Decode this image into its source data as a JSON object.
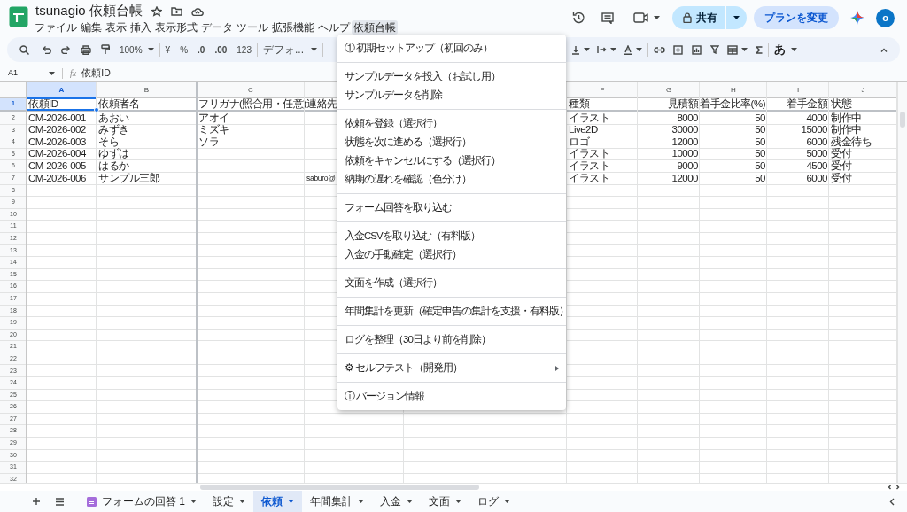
{
  "title": "tsunagio 依頼台帳",
  "menu_bar": [
    {
      "label": "ファイル",
      "selected": false
    },
    {
      "label": "編集",
      "selected": false
    },
    {
      "label": "表示",
      "selected": false
    },
    {
      "label": "挿入",
      "selected": false
    },
    {
      "label": "表示形式",
      "selected": false
    },
    {
      "label": "データ",
      "selected": false
    },
    {
      "label": "ツール",
      "selected": false
    },
    {
      "label": "拡張機能",
      "selected": false
    },
    {
      "label": "ヘルプ",
      "selected": false
    },
    {
      "label": "依頼台帳",
      "selected": true
    }
  ],
  "share_button": "共有",
  "plan_button": "プランを変更",
  "avatar": "o",
  "toolbar": {
    "zoom": "100%",
    "currency": "¥",
    "percent": "%",
    "decrease_decimal": ".0",
    "increase_decimal": ".00",
    "number_format": "123",
    "font": "デフォ...",
    "font_size_minus": "−",
    "input_tools": "あ"
  },
  "formula_bar": {
    "cell_ref": "A1",
    "fx": "fx",
    "formula": "依頼ID"
  },
  "columns": [
    {
      "letter": "A",
      "kind": "text",
      "selected": true
    },
    {
      "letter": "B",
      "kind": "text",
      "selected": false
    },
    {
      "letter": "C",
      "kind": "text",
      "selected": false
    },
    {
      "kind": "text"
    },
    {
      "kind": "text"
    },
    {
      "letter": "F",
      "kind": "text",
      "selected": false
    },
    {
      "letter": "G",
      "kind": "number",
      "selected": false
    },
    {
      "letter": "H",
      "kind": "number",
      "selected": false
    },
    {
      "letter": "I",
      "kind": "number",
      "selected": false
    },
    {
      "letter": "J",
      "kind": "text",
      "selected": false
    }
  ],
  "rows": [
    {
      "number": "1",
      "selected": true,
      "cells": {
        "0": "依頼ID",
        "1": "依頼者名",
        "2": "フリガナ(照合用・任意)",
        "3": "連絡先",
        "5": "種類",
        "6": "見積額",
        "7": "着手金比率(%)",
        "8": "着手金額",
        "9": "状態"
      }
    },
    {
      "number": "2",
      "selected": false,
      "cells": {
        "0": "CM-2026-001",
        "1": "あおい",
        "2": "アオイ",
        "5": "イラスト",
        "6": "8000",
        "7": "50",
        "8": "4000",
        "9": "制作中"
      }
    },
    {
      "number": "3",
      "selected": false,
      "cells": {
        "0": "CM-2026-002",
        "1": "みずき",
        "2": "ミズキ",
        "5": "Live2D",
        "6": "30000",
        "7": "50",
        "8": "15000",
        "9": "制作中"
      }
    },
    {
      "number": "4",
      "selected": false,
      "cells": {
        "0": "CM-2026-003",
        "1": "そら",
        "2": "ソラ",
        "5": "ロゴ",
        "6": "12000",
        "7": "50",
        "8": "6000",
        "9": "残金待ち"
      }
    },
    {
      "number": "5",
      "selected": false,
      "cells": {
        "0": "CM-2026-004",
        "1": "ゆずは",
        "5": "イラスト",
        "6": "10000",
        "7": "50",
        "8": "5000",
        "9": "受付"
      }
    },
    {
      "number": "6",
      "selected": false,
      "cells": {
        "0": "CM-2026-005",
        "1": "はるか",
        "5": "イラスト",
        "6": "9000",
        "7": "50",
        "8": "4500",
        "9": "受付"
      }
    },
    {
      "number": "7",
      "selected": false,
      "cells": {
        "0": "CM-2026-006",
        "1": "サンプル三郎",
        "3": "saburo@",
        "5": "イラスト",
        "6": "12000",
        "7": "50",
        "8": "6000",
        "9": "受付"
      }
    },
    {
      "number": "8",
      "selected": false
    },
    {
      "number": "9",
      "selected": false
    },
    {
      "number": "10",
      "selected": false
    },
    {
      "number": "11",
      "selected": false
    },
    {
      "number": "12",
      "selected": false
    },
    {
      "number": "13",
      "selected": false
    },
    {
      "number": "14",
      "selected": false
    },
    {
      "number": "15",
      "selected": false
    },
    {
      "number": "16",
      "selected": false
    },
    {
      "number": "17",
      "selected": false
    },
    {
      "number": "18",
      "selected": false
    },
    {
      "number": "19",
      "selected": false
    },
    {
      "number": "20",
      "selected": false
    },
    {
      "number": "21",
      "selected": false
    },
    {
      "number": "22",
      "selected": false
    },
    {
      "number": "23",
      "selected": false
    },
    {
      "number": "24",
      "selected": false
    },
    {
      "number": "25",
      "selected": false
    },
    {
      "number": "26",
      "selected": false
    },
    {
      "number": "27",
      "selected": false
    },
    {
      "number": "28",
      "selected": false
    },
    {
      "number": "29",
      "selected": false
    },
    {
      "number": "30",
      "selected": false
    },
    {
      "number": "31",
      "selected": false
    },
    {
      "number": "32",
      "selected": false
    }
  ],
  "dropdown_menu": [
    [
      {
        "label": "① 初期セットアップ（初回のみ）",
        "kind": "action"
      }
    ],
    [
      {
        "label": "サンプルデータを投入（お試し用）",
        "kind": "action"
      },
      {
        "label": "サンプルデータを削除",
        "kind": "action"
      }
    ],
    [
      {
        "label": "依頼を登録（選択行）",
        "kind": "action"
      },
      {
        "label": "状態を次に進める（選択行）",
        "kind": "action"
      },
      {
        "label": "依頼をキャンセルにする（選択行）",
        "kind": "action"
      },
      {
        "label": "納期の遅れを確認（色分け）",
        "kind": "action"
      }
    ],
    [
      {
        "label": "フォーム回答を取り込む",
        "kind": "action"
      }
    ],
    [
      {
        "label": "入金CSVを取り込む（有料版）",
        "kind": "action"
      },
      {
        "label": "入金の手動確定（選択行）",
        "kind": "action"
      }
    ],
    [
      {
        "label": "文面を作成（選択行）",
        "kind": "action"
      }
    ],
    [
      {
        "label": "年間集計を更新（確定申告の集計を支援・有料版）",
        "kind": "action"
      }
    ],
    [
      {
        "label": "ログを整理（30日より前を削除）",
        "kind": "action"
      }
    ],
    [
      {
        "label": "⚙ セルフテスト（開発用）",
        "kind": "submenu"
      }
    ],
    [
      {
        "label": "ⓘ バージョン情報",
        "kind": "action"
      }
    ]
  ],
  "sheet_tabs": [
    {
      "label": "フォームの回答 1",
      "kind": "form",
      "selected": false
    },
    {
      "label": "設定",
      "kind": "sheet",
      "selected": false
    },
    {
      "label": "依頼",
      "kind": "sheet",
      "selected": true
    },
    {
      "label": "年間集計",
      "kind": "sheet",
      "selected": false
    },
    {
      "label": "入金",
      "kind": "sheet",
      "selected": false
    },
    {
      "label": "文面",
      "kind": "sheet",
      "selected": false
    },
    {
      "label": "ログ",
      "kind": "sheet",
      "selected": false
    }
  ]
}
